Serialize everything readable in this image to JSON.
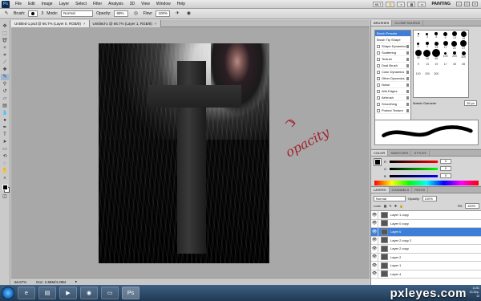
{
  "menubar": {
    "app_logo": "Ps",
    "items": [
      "File",
      "Edit",
      "Image",
      "Layer",
      "Select",
      "Filter",
      "Analysis",
      "3D",
      "View",
      "Window",
      "Help"
    ],
    "zoom": "66.7",
    "workspace": "PAINTING"
  },
  "options": {
    "brush_label": "Brush:",
    "brush_size": "3",
    "mode_label": "Mode:",
    "mode_value": "Normal",
    "opacity_label": "Opacity:",
    "opacity_value": "69%",
    "flow_label": "Flow:",
    "flow_value": "100%"
  },
  "documents": {
    "tabs": [
      {
        "label": "Untitled-1.psd @ 66.7% (Layer 0, RGB/8)",
        "active": true
      },
      {
        "label": "Untitled-1 @ 66.7% (Layer 1, RGB/8)",
        "active": false
      }
    ],
    "status": {
      "zoom": "66.67%",
      "doc": "Doc: 2.86M/4.29M"
    }
  },
  "annotation": {
    "text": "opacity",
    "color": "#a3202e"
  },
  "brushes": {
    "tabs": [
      "BRUSHES",
      "CLONE SOURCE"
    ],
    "list": [
      {
        "label": "Brush Presets",
        "active": true,
        "checkbox": false
      },
      {
        "label": "Brush Tip Shape",
        "active": false,
        "checkbox": false
      },
      {
        "label": "Shape Dynamics",
        "active": false,
        "checkbox": true
      },
      {
        "label": "Scattering",
        "active": false,
        "checkbox": true
      },
      {
        "label": "Texture",
        "active": false,
        "checkbox": true
      },
      {
        "label": "Dual Brush",
        "active": false,
        "checkbox": true
      },
      {
        "label": "Color Dynamics",
        "active": false,
        "checkbox": true
      },
      {
        "label": "Other Dynamics",
        "active": false,
        "checkbox": true
      },
      {
        "label": "Noise",
        "active": false,
        "checkbox": true
      },
      {
        "label": "Wet Edges",
        "active": false,
        "checkbox": true
      },
      {
        "label": "Airbrush",
        "active": false,
        "checkbox": true
      },
      {
        "label": "Smoothing",
        "active": false,
        "checkbox": true
      },
      {
        "label": "Protect Texture",
        "active": false,
        "checkbox": true
      }
    ],
    "tip_labels": [
      "1",
      "3",
      "5",
      "9",
      "13",
      "19",
      "5",
      "9",
      "13",
      "17",
      "21",
      "27",
      "35",
      "45",
      "65",
      "100",
      "200",
      "300",
      "9",
      "13",
      "19",
      "17",
      "45",
      "65",
      "100",
      "200",
      "300"
    ],
    "master_label": "Master Diameter",
    "master_value": "35 px"
  },
  "color": {
    "tabs": [
      "COLOR",
      "SWATCHES",
      "STYLES"
    ],
    "channels": [
      {
        "label": "R",
        "value": "0"
      },
      {
        "label": "G",
        "value": "0"
      },
      {
        "label": "B",
        "value": "0"
      }
    ]
  },
  "layers": {
    "tabs": [
      "LAYERS",
      "CHANNELS",
      "PATHS"
    ],
    "blend": "Normal",
    "opacity_label": "Opacity:",
    "opacity": "100%",
    "lock_label": "Lock:",
    "fill_label": "Fill:",
    "fill": "100%",
    "items": [
      {
        "label": "Layer 1 copy",
        "active": false
      },
      {
        "label": "Layer 0 copy",
        "active": false
      },
      {
        "label": "Layer 0",
        "active": true
      },
      {
        "label": "Layer 2 copy 2",
        "active": false
      },
      {
        "label": "Layer 2 copy",
        "active": false
      },
      {
        "label": "Layer 2",
        "active": false
      },
      {
        "label": "Layer 1",
        "active": false
      },
      {
        "label": "Layer 4",
        "active": false
      }
    ]
  },
  "taskbar": {
    "watermark": "pxleyes.com",
    "clock_time": "11:51",
    "clock_date": "13-Sep-10"
  }
}
